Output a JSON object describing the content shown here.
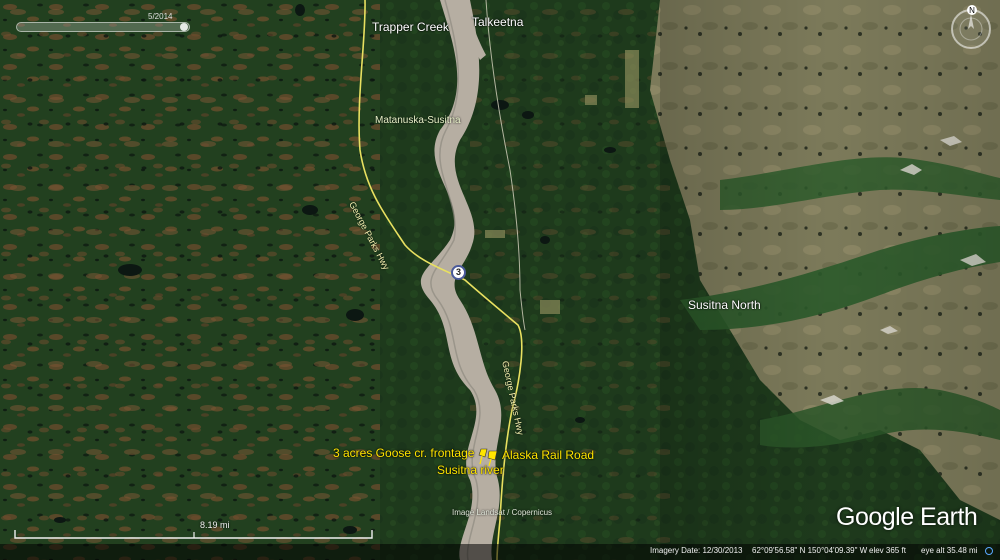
{
  "places": {
    "trapper_creek": "Trapper Creek",
    "talkeetna": "Talkeetna",
    "susitna_north": "Susitna North"
  },
  "regions": {
    "matanuska_susitna": "Matanuska-Susitna"
  },
  "roads": {
    "parks_hwy": "George Parks Hwy",
    "parks_hwy_north": "George Parks Hwy",
    "highway_shield": "3"
  },
  "pins": {
    "goose_creek": "3 acres Goose cr. frontage",
    "rail_road": "Alaska Rail Road",
    "susitna_river": "Susitna river"
  },
  "time_slider": {
    "year": "5/2014"
  },
  "scale": {
    "label": "8.19 mi"
  },
  "credits": {
    "imagery": "Image Landsat / Copernicus"
  },
  "status_bar": {
    "imagery_date": "Imagery Date: 12/30/2013",
    "coordinates": "62°09'56.58\" N  150°04'09.39\" W",
    "elevation": "elev   365 ft",
    "eye_alt": "eye alt   35.48 mi"
  },
  "branding": {
    "logo": "Google Earth"
  },
  "compass": {
    "north_letter": "N"
  },
  "colors": {
    "forest": "#1f3d1f",
    "river": "#b9b2a6",
    "road": "#e8e060",
    "pin": "#ffe600"
  }
}
